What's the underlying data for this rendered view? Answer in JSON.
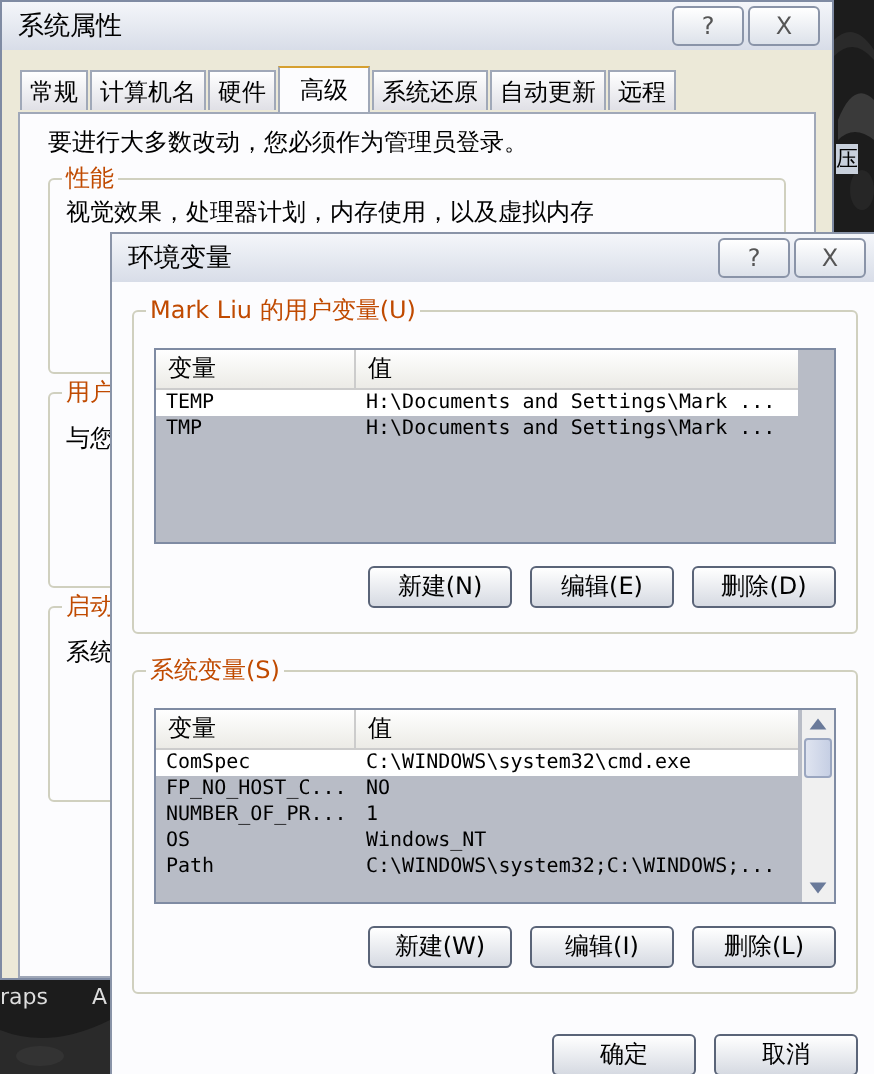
{
  "desktop": {
    "labels": [
      {
        "text": "压"
      },
      {
        "text": "raps"
      },
      {
        "text": "A"
      }
    ]
  },
  "system_properties": {
    "title": "系统属性",
    "help_button": "?",
    "close_button": "X",
    "tabs": [
      {
        "label": "常规",
        "selected": false
      },
      {
        "label": "计算机名",
        "selected": false
      },
      {
        "label": "硬件",
        "selected": false
      },
      {
        "label": "高级",
        "selected": true
      },
      {
        "label": "系统还原",
        "selected": false
      },
      {
        "label": "自动更新",
        "selected": false
      },
      {
        "label": "远程",
        "selected": false
      }
    ],
    "notice": "要进行大多数改动，您必须作为管理员登录。",
    "groups": [
      {
        "title": "性能",
        "text": "视觉效果，处理器计划，内存使用，以及虚拟内存"
      },
      {
        "title": "用户",
        "text": "与您"
      },
      {
        "title": "启动",
        "text": "系统"
      }
    ]
  },
  "environment_variables": {
    "title": "环境变量",
    "help_button": "?",
    "close_button": "X",
    "user_group": {
      "title": "Mark Liu 的用户变量(U)",
      "columns": [
        "变量",
        "值"
      ],
      "rows": [
        {
          "name": "TEMP",
          "value": "H:\\Documents and Settings\\Mark ...",
          "selected": true
        },
        {
          "name": "TMP",
          "value": "H:\\Documents and Settings\\Mark ...",
          "selected": false
        }
      ],
      "buttons": [
        "新建(N)",
        "编辑(E)",
        "删除(D)"
      ]
    },
    "system_group": {
      "title": "系统变量(S)",
      "columns": [
        "变量",
        "值"
      ],
      "rows": [
        {
          "name": "ComSpec",
          "value": "C:\\WINDOWS\\system32\\cmd.exe",
          "selected": true
        },
        {
          "name": "FP_NO_HOST_C...",
          "value": "NO",
          "selected": false
        },
        {
          "name": "NUMBER_OF_PR...",
          "value": "1",
          "selected": false
        },
        {
          "name": "OS",
          "value": "Windows_NT",
          "selected": false
        },
        {
          "name": "Path",
          "value": "C:\\WINDOWS\\system32;C:\\WINDOWS;...",
          "selected": false
        }
      ],
      "buttons": [
        "新建(W)",
        "编辑(I)",
        "删除(L)"
      ]
    },
    "buttons": [
      "确定",
      "取消"
    ]
  }
}
